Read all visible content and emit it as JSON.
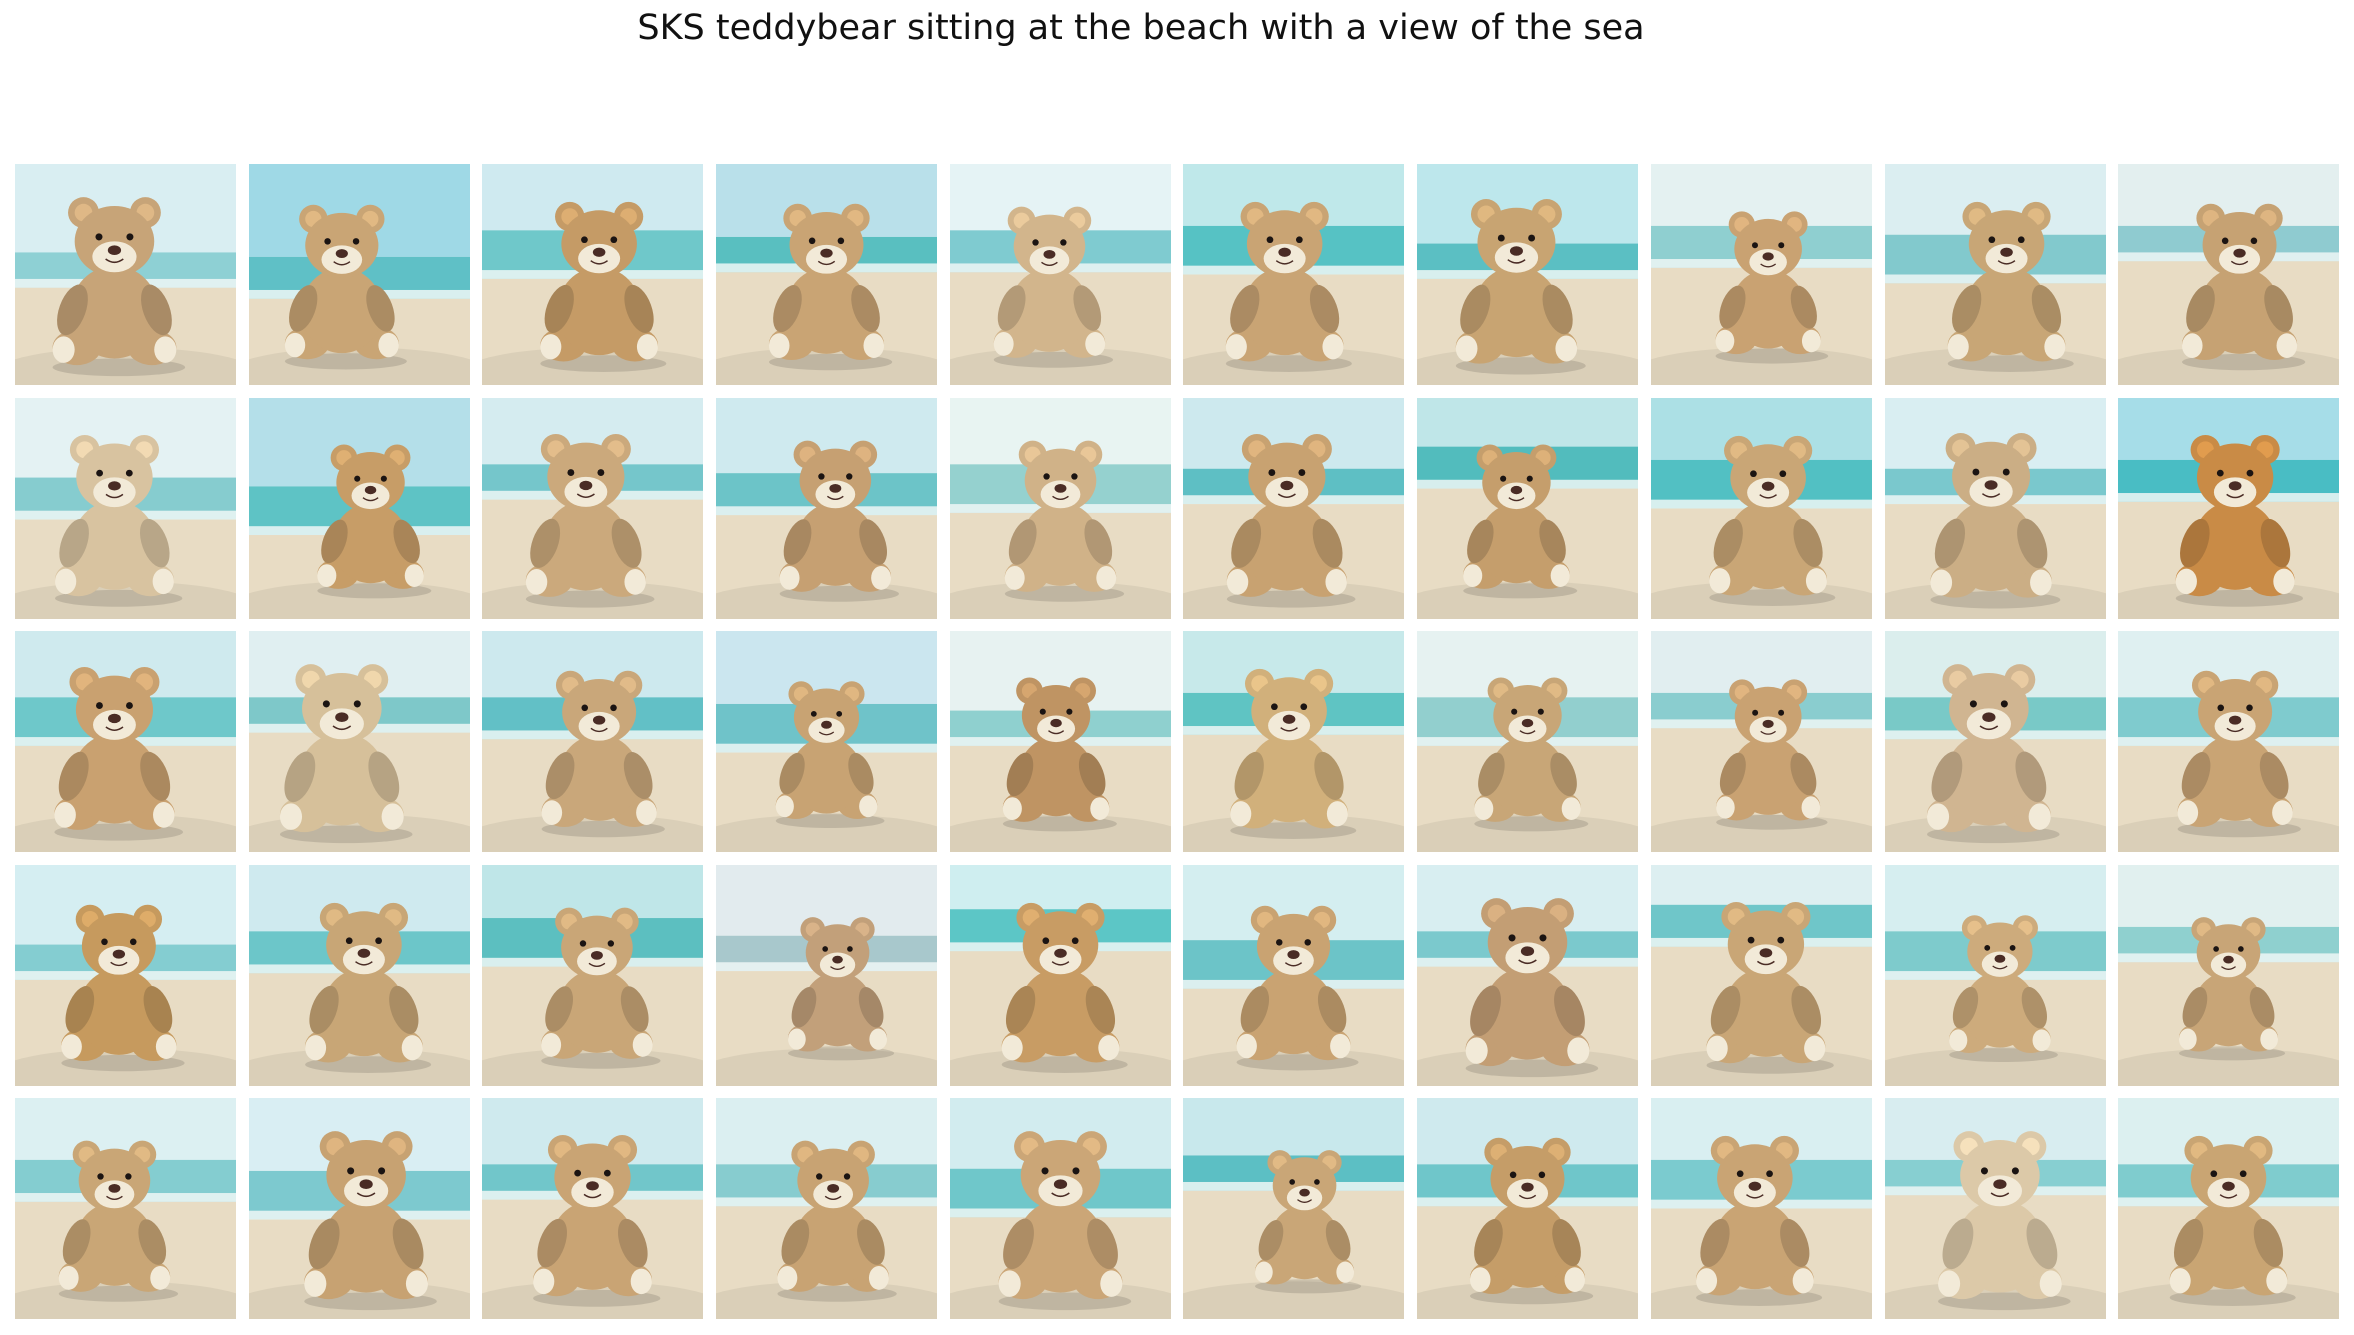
{
  "title": "SKS teddybear sitting at the beach with a view of the sea",
  "colors": {
    "sky": "#dff3f5",
    "sea": "#7fcfd1",
    "sand": "#e8dcc4",
    "bear_fur": "#c9a576",
    "bear_muzzle": "#f2ead8",
    "nose": "#4a2c25"
  },
  "grid": {
    "columns": 10,
    "rows": 5,
    "tiles": [
      {
        "bear": "#c7a478",
        "sky": "#d9eef2",
        "sea": "#8ed0d4",
        "horizon": 0.4,
        "scale": 1.0,
        "offset": -0.05
      },
      {
        "bear": "#c9a575",
        "sky": "#9fd9e6",
        "sea": "#5fc0c6",
        "horizon": 0.42,
        "scale": 0.92,
        "offset": -0.08
      },
      {
        "bear": "#c59b66",
        "sky": "#cfeaf0",
        "sea": "#6fc8ca",
        "horizon": 0.3,
        "scale": 0.95,
        "offset": 0.03
      },
      {
        "bear": "#c9a474",
        "sky": "#b9e0ea",
        "sea": "#59bfc0",
        "horizon": 0.33,
        "scale": 0.93,
        "offset": 0.0
      },
      {
        "bear": "#d2b58c",
        "sky": "#e5f3f5",
        "sea": "#7fcbd0",
        "horizon": 0.3,
        "scale": 0.9,
        "offset": -0.05
      },
      {
        "bear": "#c9a474",
        "sky": "#bfe8ea",
        "sea": "#56c2c4",
        "horizon": 0.28,
        "scale": 0.95,
        "offset": -0.04
      },
      {
        "bear": "#c8a472",
        "sky": "#bde7ec",
        "sea": "#5bbfc3",
        "horizon": 0.36,
        "scale": 0.98,
        "offset": -0.05
      },
      {
        "bear": "#c9a272",
        "sky": "#e4f1f1",
        "sea": "#8fcfd0",
        "horizon": 0.28,
        "scale": 0.85,
        "offset": 0.03
      },
      {
        "bear": "#c8a676",
        "sky": "#dbeef1",
        "sea": "#82c9cd",
        "horizon": 0.32,
        "scale": 0.95,
        "offset": 0.05
      },
      {
        "bear": "#c6a273",
        "sky": "#e3efef",
        "sea": "#8fcbd0",
        "horizon": 0.28,
        "scale": 0.93,
        "offset": 0.05
      },
      {
        "bear": "#d8c3a0",
        "sky": "#e4f2f3",
        "sea": "#86cccf",
        "horizon": 0.36,
        "scale": 0.96,
        "offset": -0.05
      },
      {
        "bear": "#c79d67",
        "sky": "#b4dfe9",
        "sea": "#5ec3c5",
        "horizon": 0.4,
        "scale": 0.86,
        "offset": 0.05
      },
      {
        "bear": "#cba97c",
        "sky": "#d5ecf0",
        "sea": "#75c6cb",
        "horizon": 0.3,
        "scale": 0.97,
        "offset": -0.03
      },
      {
        "bear": "#c6a072",
        "sky": "#cfeaef",
        "sea": "#6cc4c8",
        "horizon": 0.34,
        "scale": 0.9,
        "offset": 0.04
      },
      {
        "bear": "#d0b288",
        "sky": "#e8f4f2",
        "sea": "#95d1cf",
        "horizon": 0.3,
        "scale": 0.9,
        "offset": 0.0
      },
      {
        "bear": "#c8a271",
        "sky": "#cde9ee",
        "sea": "#5ebfc4",
        "horizon": 0.32,
        "scale": 0.97,
        "offset": -0.03
      },
      {
        "bear": "#c59e6c",
        "sky": "#bfe6e8",
        "sea": "#52bcbd",
        "horizon": 0.22,
        "scale": 0.86,
        "offset": -0.05
      },
      {
        "bear": "#c9a676",
        "sky": "#ace0e5",
        "sea": "#52c0c3",
        "horizon": 0.28,
        "scale": 0.95,
        "offset": 0.03
      },
      {
        "bear": "#cbae85",
        "sky": "#d9eef2",
        "sea": "#7ac8cd",
        "horizon": 0.32,
        "scale": 0.98,
        "offset": -0.02
      },
      {
        "bear": "#c98b46",
        "sky": "#a6dde8",
        "sea": "#49bdc4",
        "horizon": 0.28,
        "scale": 0.96,
        "offset": 0.03
      },
      {
        "bear": "#c9a170",
        "sky": "#cfeaee",
        "sea": "#6ec8ca",
        "horizon": 0.3,
        "scale": 0.97,
        "offset": -0.05
      },
      {
        "bear": "#d6c09a",
        "sky": "#e0eff1",
        "sea": "#7ec8c9",
        "horizon": 0.3,
        "scale": 1.0,
        "offset": -0.08
      },
      {
        "bear": "#c9a77a",
        "sky": "#cde9ee",
        "sea": "#62c0c6",
        "horizon": 0.3,
        "scale": 0.93,
        "offset": 0.03
      },
      {
        "bear": "#c8a373",
        "sky": "#cbe6ef",
        "sea": "#6fc3c9",
        "horizon": 0.33,
        "scale": 0.82,
        "offset": 0.0
      },
      {
        "bear": "#bf9463",
        "sky": "#e7f2f1",
        "sea": "#8fd0cf",
        "horizon": 0.36,
        "scale": 0.86,
        "offset": -0.02
      },
      {
        "bear": "#d1b07b",
        "sky": "#c7e9ea",
        "sea": "#5fc4c3",
        "horizon": 0.28,
        "scale": 0.95,
        "offset": -0.02
      },
      {
        "bear": "#c8a677",
        "sky": "#e6f2f1",
        "sea": "#92cfce",
        "horizon": 0.3,
        "scale": 0.86,
        "offset": 0.0
      },
      {
        "bear": "#c9a272",
        "sky": "#e1eef0",
        "sea": "#8acdcf",
        "horizon": 0.28,
        "scale": 0.84,
        "offset": 0.03
      },
      {
        "bear": "#d0b591",
        "sky": "#dbeeed",
        "sea": "#79c9c7",
        "horizon": 0.3,
        "scale": 1.0,
        "offset": -0.03
      },
      {
        "bear": "#c9a474",
        "sky": "#dff0f1",
        "sea": "#7fcbce",
        "horizon": 0.3,
        "scale": 0.93,
        "offset": 0.03
      },
      {
        "bear": "#c69a5e",
        "sky": "#d5eef2",
        "sea": "#84cdd1",
        "horizon": 0.36,
        "scale": 0.93,
        "offset": -0.03
      },
      {
        "bear": "#c8a676",
        "sky": "#cfeaef",
        "sea": "#6cc6c9",
        "horizon": 0.3,
        "scale": 0.95,
        "offset": 0.02
      },
      {
        "bear": "#c9a677",
        "sky": "#bfe6e8",
        "sea": "#5cbfc0",
        "horizon": 0.24,
        "scale": 0.9,
        "offset": 0.02
      },
      {
        "bear": "#c2a07a",
        "sky": "#e2ebee",
        "sea": "#a8c8cc",
        "horizon": 0.32,
        "scale": 0.8,
        "offset": 0.05
      },
      {
        "bear": "#c89c64",
        "sky": "#cfeef0",
        "sea": "#5cc6c6",
        "horizon": 0.2,
        "scale": 0.95,
        "offset": 0.0
      },
      {
        "bear": "#c9a372",
        "sky": "#d4eef0",
        "sea": "#6cc4c8",
        "horizon": 0.34,
        "scale": 0.92,
        "offset": 0.0
      },
      {
        "bear": "#c39e74",
        "sky": "#d8eef1",
        "sea": "#7bc9cd",
        "horizon": 0.3,
        "scale": 1.0,
        "offset": 0.0
      },
      {
        "bear": "#c9a676",
        "sky": "#ddeff1",
        "sea": "#6fc6c9",
        "horizon": 0.18,
        "scale": 0.96,
        "offset": 0.02
      },
      {
        "bear": "#cdab7c",
        "sky": "#d6eef0",
        "sea": "#7ecbcc",
        "horizon": 0.3,
        "scale": 0.82,
        "offset": 0.02
      },
      {
        "bear": "#c8a577",
        "sky": "#e1f0ef",
        "sea": "#8fd0cf",
        "horizon": 0.28,
        "scale": 0.8,
        "offset": 0.0
      },
      {
        "bear": "#c9a676",
        "sky": "#dcf0f2",
        "sea": "#84cdd0",
        "horizon": 0.28,
        "scale": 0.9,
        "offset": -0.05
      },
      {
        "bear": "#c7a272",
        "sky": "#d9eef3",
        "sea": "#7dc9cf",
        "horizon": 0.33,
        "scale": 1.0,
        "offset": 0.03
      },
      {
        "bear": "#c9a474",
        "sky": "#cfeaee",
        "sea": "#71c6ca",
        "horizon": 0.3,
        "scale": 0.96,
        "offset": 0.0
      },
      {
        "bear": "#c8a373",
        "sky": "#dbeff1",
        "sea": "#87cccf",
        "horizon": 0.3,
        "scale": 0.9,
        "offset": 0.03
      },
      {
        "bear": "#cba677",
        "sky": "#d2ecef",
        "sea": "#6fc7ca",
        "horizon": 0.32,
        "scale": 1.0,
        "offset": 0.0
      },
      {
        "bear": "#c9a677",
        "sky": "#c8e8ec",
        "sea": "#5cbfc4",
        "horizon": 0.26,
        "scale": 0.8,
        "offset": 0.05
      },
      {
        "bear": "#c59d68",
        "sky": "#cfeaee",
        "sea": "#6fc6ca",
        "horizon": 0.3,
        "scale": 0.93,
        "offset": 0.0
      },
      {
        "bear": "#c9a474",
        "sky": "#d9eff1",
        "sea": "#7bcbcf",
        "horizon": 0.28,
        "scale": 0.95,
        "offset": -0.03
      },
      {
        "bear": "#dcc9a8",
        "sky": "#d8edf0",
        "sea": "#87cfd1",
        "horizon": 0.28,
        "scale": 1.0,
        "offset": 0.02
      },
      {
        "bear": "#c9a573",
        "sky": "#dcf0f0",
        "sea": "#7fccce",
        "horizon": 0.3,
        "scale": 0.95,
        "offset": 0.0
      }
    ]
  }
}
